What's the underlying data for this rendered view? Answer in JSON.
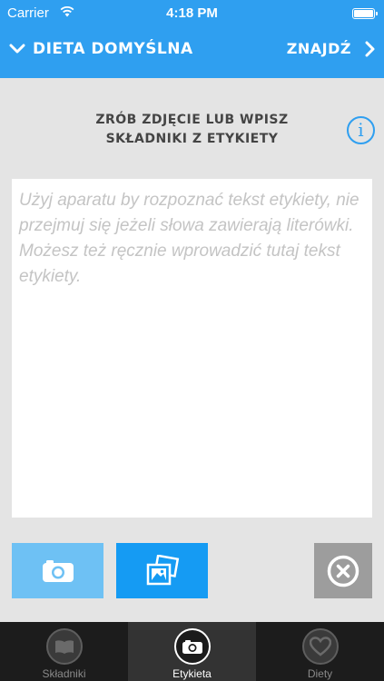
{
  "status_bar": {
    "carrier": "Carrier",
    "time": "4:18 PM"
  },
  "nav": {
    "title": "DIETA DOMYŚLNA",
    "action": "ZNAJDŹ"
  },
  "main": {
    "heading_line1": "ZRÓB ZDJĘCIE LUB WPISZ",
    "heading_line2": "SKŁADNIKI Z ETYKIETY",
    "info_label": "i",
    "label_text_value": "",
    "label_text_placeholder": "Użyj aparatu by rozpoznać tekst etykiety, nie przejmuj się jeżeli słowa zawierają literówki. Możesz też ręcznie wprowadzić tutaj tekst etykiety."
  },
  "tabbar": {
    "tabs": [
      {
        "label": "Składniki",
        "icon": "book-icon",
        "active": false
      },
      {
        "label": "Etykieta",
        "icon": "camera-icon",
        "active": true
      },
      {
        "label": "Diety",
        "icon": "heart-icon",
        "active": false
      }
    ]
  },
  "colors": {
    "accent": "#2f9ff0",
    "camera_button": "#6ec1f4",
    "gallery_button": "#159bf3",
    "clear_button": "#9d9d9d",
    "tabbar": "#1c1c1c"
  }
}
